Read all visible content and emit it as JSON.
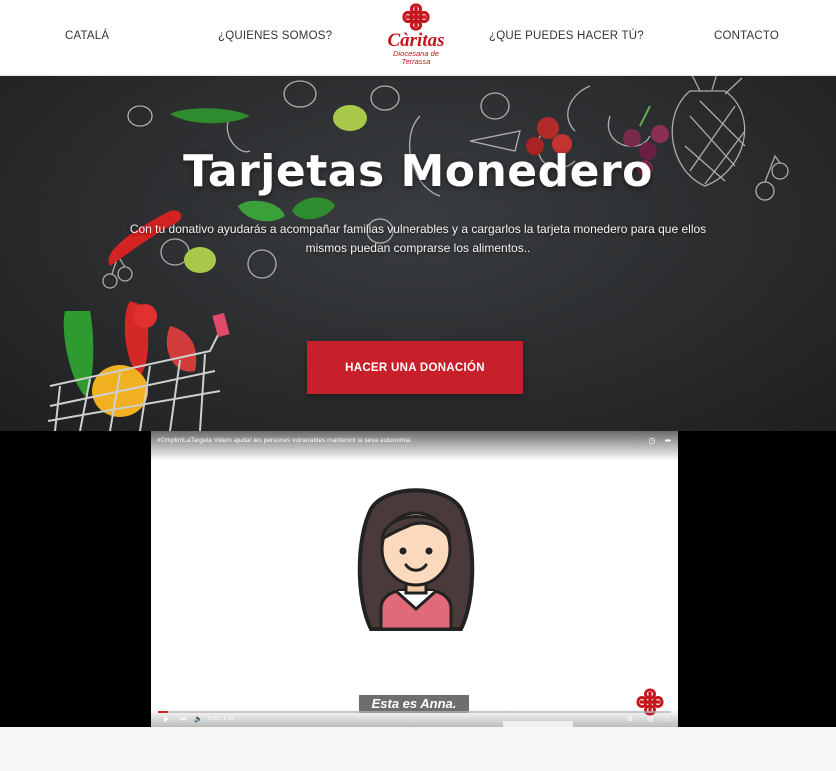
{
  "nav": {
    "catala": "CATALÁ",
    "quienes": "¿QUIENES SOMOS?",
    "hacer": "¿QUE PUEDES HACER TÚ?",
    "contacto": "CONTACTO"
  },
  "logo": {
    "name": "Càritas",
    "sub1": "Diocesana de",
    "sub2": "Terrassa"
  },
  "hero": {
    "title": "Tarjetas Monedero",
    "description": "Con tu donativo ayudarás a acompañar familias vulnerables y a cargarlos la tarjeta monedero para que ellos mismos puedan comprarse los alimentos..",
    "button": "HACER UNA DONACIÓN"
  },
  "video": {
    "title": "#OmplimLaTargeta Volem ajudar les persones vulnerables mantenint la seva autonomia.",
    "subtitle": "Esta es Anna.",
    "time": "0:01 / 1:42",
    "progress": 0.02
  },
  "colors": {
    "brand_red": "#c4161c",
    "button_red": "#c8202a"
  }
}
